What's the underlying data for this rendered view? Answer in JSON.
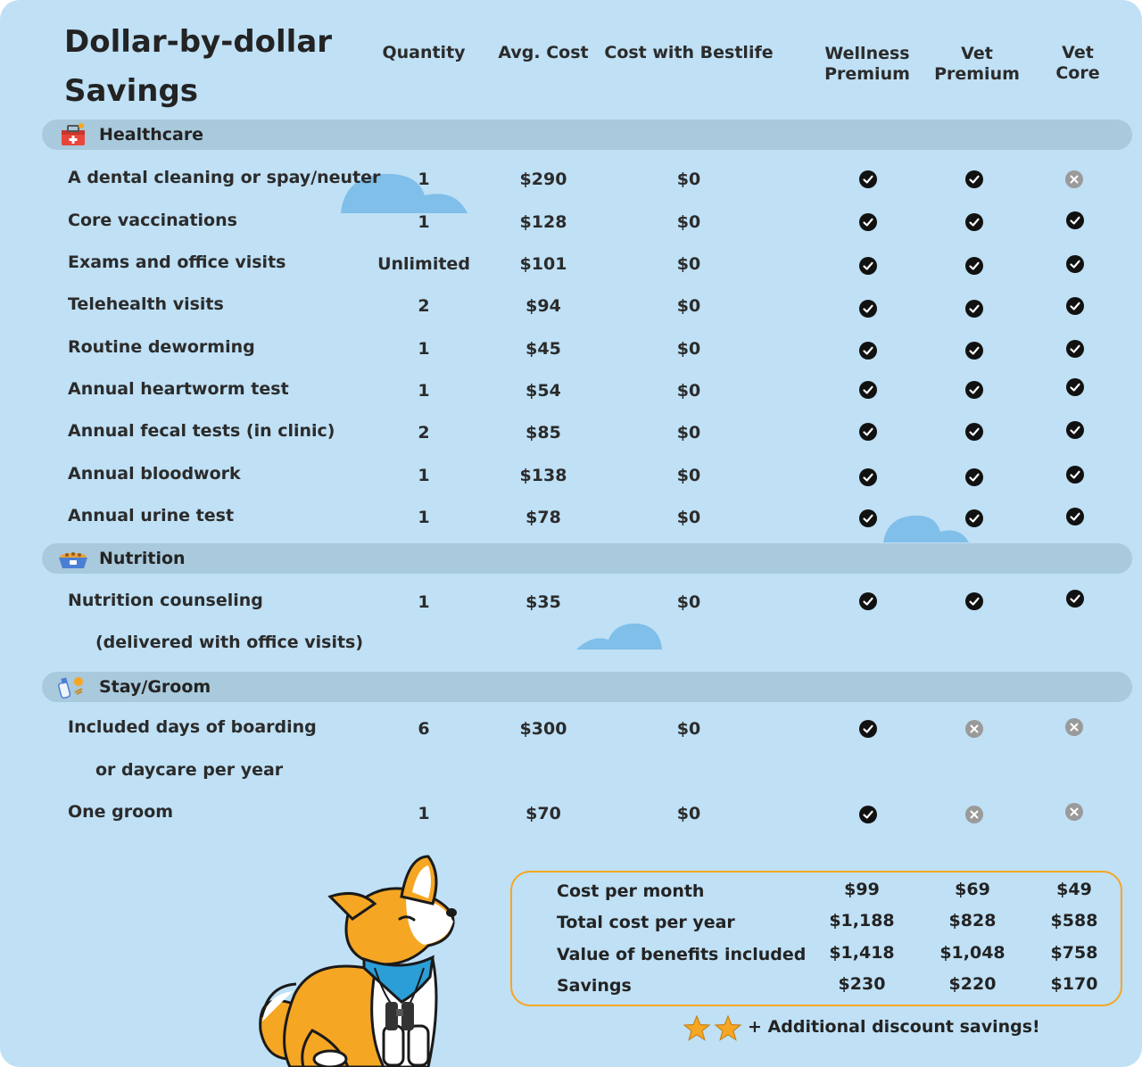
{
  "title": {
    "line1": "Dollar-by-dollar",
    "line2": "Savings"
  },
  "headers": {
    "quantity": "Quantity",
    "avg_cost": "Avg. Cost",
    "cost_bestlife": "Cost with Bestlife",
    "plans": [
      {
        "line1": "Wellness",
        "line2": "Premium"
      },
      {
        "line1": "Vet",
        "line2": "Premium"
      },
      {
        "line1": "Vet",
        "line2": "Core"
      }
    ]
  },
  "sections": [
    {
      "name": "Healthcare",
      "icon": "first-aid-kit-icon",
      "rows": [
        {
          "label": "A dental cleaning or spay/neuter",
          "qty": "1",
          "avg": "$290",
          "best": "$0",
          "included": [
            true,
            true,
            false
          ]
        },
        {
          "label": "Core vaccinations",
          "qty": "1",
          "avg": "$128",
          "best": "$0",
          "included": [
            true,
            true,
            true
          ]
        },
        {
          "label": "Exams and office visits",
          "qty": "Unlimited",
          "avg": "$101",
          "best": "$0",
          "included": [
            true,
            true,
            true
          ]
        },
        {
          "label": "Telehealth visits",
          "qty": "2",
          "avg": "$94",
          "best": "$0",
          "included": [
            true,
            true,
            true
          ]
        },
        {
          "label": "Routine deworming",
          "qty": "1",
          "avg": "$45",
          "best": "$0",
          "included": [
            true,
            true,
            true
          ]
        },
        {
          "label": "Annual heartworm test",
          "qty": "1",
          "avg": "$54",
          "best": "$0",
          "included": [
            true,
            true,
            true
          ]
        },
        {
          "label": "Annual fecal tests (in clinic)",
          "qty": "2",
          "avg": "$85",
          "best": "$0",
          "included": [
            true,
            true,
            true
          ]
        },
        {
          "label": "Annual bloodwork",
          "qty": "1",
          "avg": "$138",
          "best": "$0",
          "included": [
            true,
            true,
            true
          ]
        },
        {
          "label": "Annual urine test",
          "qty": "1",
          "avg": "$78",
          "best": "$0",
          "included": [
            true,
            true,
            true
          ]
        }
      ]
    },
    {
      "name": "Nutrition",
      "icon": "food-bowl-icon",
      "rows": [
        {
          "label": "Nutrition counseling",
          "label2": "(delivered with office visits)",
          "qty": "1",
          "avg": "$35",
          "best": "$0",
          "included": [
            true,
            true,
            true
          ]
        }
      ]
    },
    {
      "name": "Stay/Groom",
      "icon": "grooming-bottle-icon",
      "rows": [
        {
          "label": "Included days of boarding",
          "label2": "or daycare per year",
          "qty": "6",
          "avg": "$300",
          "best": "$0",
          "included": [
            true,
            false,
            false
          ]
        },
        {
          "label": "One groom",
          "qty": "1",
          "avg": "$70",
          "best": "$0",
          "included": [
            true,
            false,
            false
          ]
        }
      ]
    }
  ],
  "summary": [
    {
      "label": "Cost per month",
      "values": [
        "$99",
        "$69",
        "$49"
      ]
    },
    {
      "label": "Total cost per year",
      "values": [
        "$1,188",
        "$828",
        "$588"
      ]
    },
    {
      "label": "Value of benefits included",
      "values": [
        "$1,418",
        "$1,048",
        "$758"
      ]
    },
    {
      "label": "Savings",
      "values": [
        "$230",
        "$220",
        "$170"
      ]
    }
  ],
  "extra_note": "+ Additional discount savings!",
  "colors": {
    "background": "#bfe0f5",
    "band": "#a9c9dc",
    "accent": "#f5a623",
    "cloud": "#7fbfe9",
    "check": "#111111",
    "cross": "#9a9a9a"
  }
}
